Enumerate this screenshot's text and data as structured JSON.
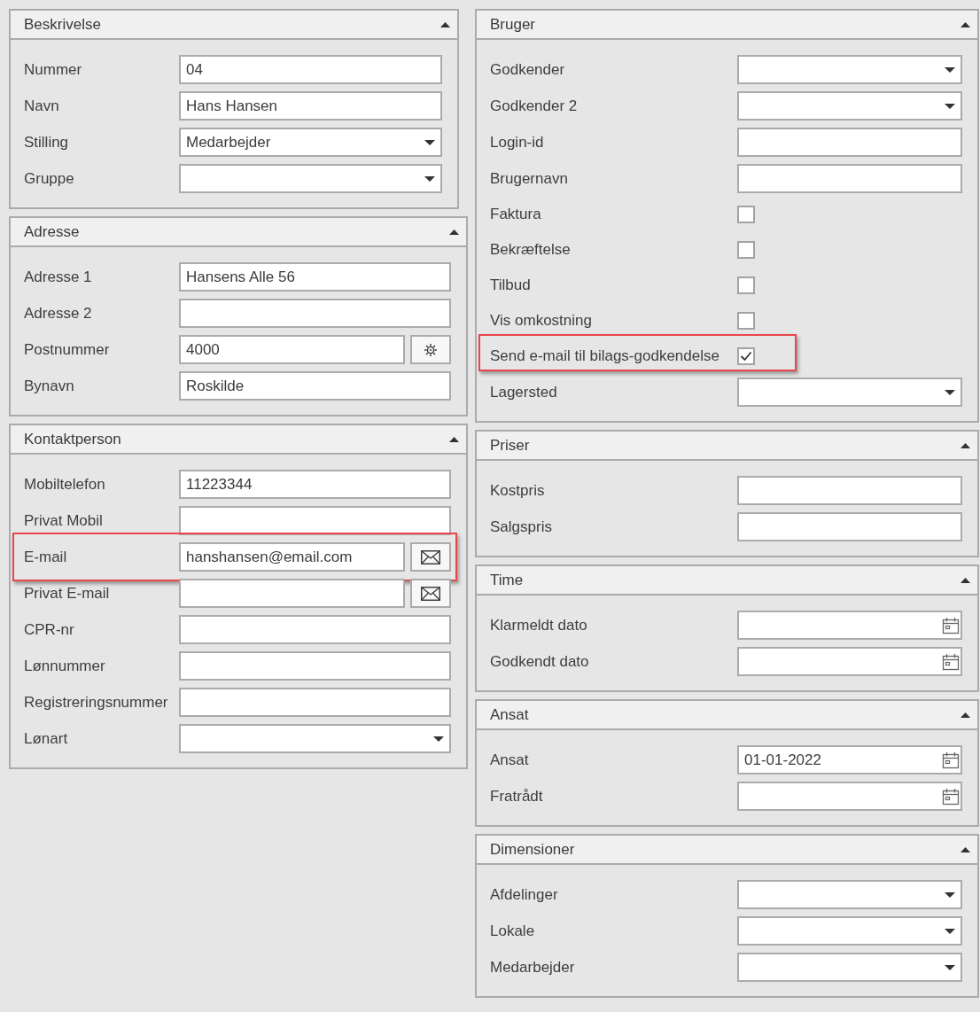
{
  "left_panels": [
    {
      "title": "Beskrivelse",
      "expanded": true,
      "rows": [
        {
          "kind": "text",
          "label": "Nummer",
          "value": "04",
          "highlighted": false
        },
        {
          "kind": "text",
          "label": "Navn",
          "value": "Hans Hansen",
          "highlighted": false
        },
        {
          "kind": "dropdown",
          "label": "Stilling",
          "value": "Medarbejder",
          "highlighted": false
        },
        {
          "kind": "dropdown",
          "label": "Gruppe",
          "highlighted": false
        }
      ]
    },
    {
      "title": "Adresse",
      "expanded": true,
      "rows": [
        {
          "kind": "text",
          "label": "Adresse 1",
          "value": "Hansens Alle 56",
          "highlighted": false
        },
        {
          "kind": "text",
          "label": "Adresse 2",
          "highlighted": false
        },
        {
          "kind": "lookup",
          "label": "Postnummer",
          "value": "4000",
          "highlighted": false
        },
        {
          "kind": "text",
          "label": "Bynavn",
          "value": "Roskilde",
          "highlighted": false
        }
      ]
    },
    {
      "title": "Kontaktperson",
      "expanded": true,
      "rows": [
        {
          "kind": "text",
          "label": "Mobiltelefon",
          "value": "11223344",
          "highlighted": false
        },
        {
          "kind": "text",
          "label": "Privat Mobil",
          "highlighted": false
        },
        {
          "kind": "email",
          "label": "E-mail",
          "value": "hanshansen@email.com",
          "highlighted": true
        },
        {
          "kind": "email",
          "label": "Privat E-mail",
          "highlighted": false
        },
        {
          "kind": "text",
          "label": "CPR-nr",
          "highlighted": false
        },
        {
          "kind": "text",
          "label": "Lønnummer",
          "highlighted": false
        },
        {
          "kind": "text",
          "label": "Registreringsnummer",
          "highlighted": false
        },
        {
          "kind": "dropdown",
          "label": "Lønart",
          "highlighted": false
        }
      ]
    }
  ],
  "right_panels": [
    {
      "title": "Bruger",
      "expanded": true,
      "rows": [
        {
          "kind": "dropdown",
          "label": "Godkender",
          "highlighted": false
        },
        {
          "kind": "dropdown",
          "label": "Godkender 2",
          "highlighted": false
        },
        {
          "kind": "text",
          "label": "Login-id",
          "highlighted": false
        },
        {
          "kind": "text",
          "label": "Brugernavn",
          "highlighted": false
        },
        {
          "kind": "checkbox",
          "label": "Faktura",
          "checked": false,
          "highlighted": false
        },
        {
          "kind": "checkbox",
          "label": "Bekræftelse",
          "checked": false,
          "highlighted": false
        },
        {
          "kind": "checkbox",
          "label": "Tilbud",
          "checked": false,
          "highlighted": false
        },
        {
          "kind": "checkbox",
          "label": "Vis omkostning",
          "checked": false,
          "highlighted": false
        },
        {
          "kind": "checkbox",
          "label": "Send e-mail til bilags-godkendelse",
          "checked": true,
          "highlighted": true
        },
        {
          "kind": "dropdown",
          "label": "Lagersted",
          "highlighted": false
        }
      ]
    },
    {
      "title": "Priser",
      "expanded": true,
      "rows": [
        {
          "kind": "text",
          "label": "Kostpris",
          "highlighted": false
        },
        {
          "kind": "text",
          "label": "Salgspris",
          "highlighted": false
        }
      ]
    },
    {
      "title": "Time",
      "expanded": true,
      "rows": [
        {
          "kind": "date",
          "label": "Klarmeldt dato",
          "highlighted": false
        },
        {
          "kind": "date",
          "label": "Godkendt dato",
          "highlighted": false
        }
      ]
    },
    {
      "title": "Ansat",
      "expanded": true,
      "rows": [
        {
          "kind": "date",
          "label": "Ansat",
          "value": "01-01-2022",
          "highlighted": false
        },
        {
          "kind": "date",
          "label": "Fratrådt",
          "highlighted": false
        }
      ]
    },
    {
      "title": "Dimensioner",
      "expanded": true,
      "rows": [
        {
          "kind": "dropdown",
          "label": "Afdelinger",
          "highlighted": false
        },
        {
          "kind": "dropdown",
          "label": "Lokale",
          "highlighted": false
        },
        {
          "kind": "dropdown",
          "label": "Medarbejder",
          "highlighted": false
        }
      ]
    }
  ]
}
